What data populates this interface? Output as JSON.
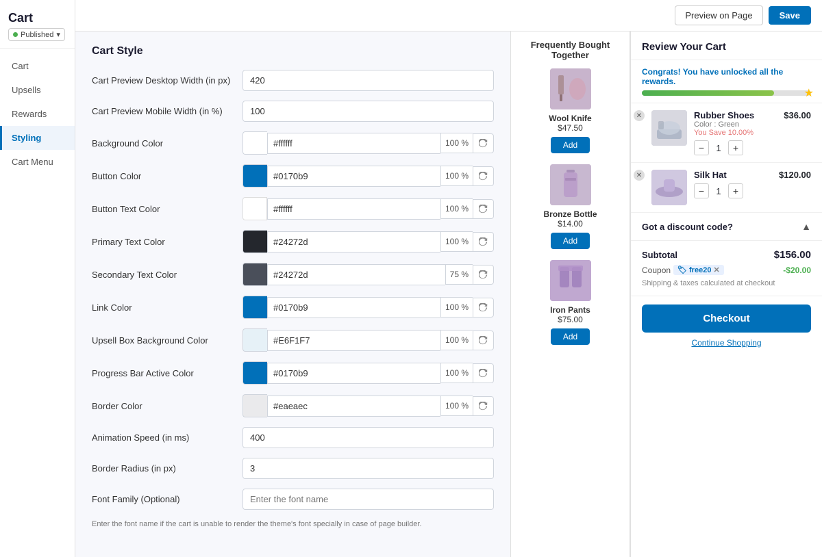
{
  "app": {
    "title": "Cart",
    "published_label": "Published",
    "preview_btn": "Preview on Page",
    "save_btn": "Save"
  },
  "sidebar": {
    "items": [
      {
        "id": "cart",
        "label": "Cart"
      },
      {
        "id": "upsells",
        "label": "Upsells"
      },
      {
        "id": "rewards",
        "label": "Rewards"
      },
      {
        "id": "styling",
        "label": "Styling"
      },
      {
        "id": "cart-menu",
        "label": "Cart Menu"
      }
    ]
  },
  "settings": {
    "panel_title": "Cart Style",
    "fields": [
      {
        "id": "desktop-width",
        "label": "Cart Preview Desktop Width (in px)",
        "type": "text",
        "value": "420"
      },
      {
        "id": "mobile-width",
        "label": "Cart Preview Mobile Width (in %)",
        "type": "text",
        "value": "100"
      },
      {
        "id": "background-color",
        "label": "Background Color",
        "type": "color",
        "hex": "#ffffff",
        "pct": "100"
      },
      {
        "id": "button-color",
        "label": "Button Color",
        "type": "color",
        "hex": "#0170b9",
        "pct": "100",
        "swatch": "#0170b9"
      },
      {
        "id": "button-text-color",
        "label": "Button Text Color",
        "type": "color",
        "hex": "#ffffff",
        "pct": "100"
      },
      {
        "id": "primary-text-color",
        "label": "Primary Text Color",
        "type": "color",
        "hex": "#24272d",
        "pct": "100",
        "swatch": "#24272d"
      },
      {
        "id": "secondary-text-color",
        "label": "Secondary Text Color",
        "type": "color",
        "hex": "#24272d",
        "pct": "75",
        "swatch": "#4a4f5a"
      },
      {
        "id": "link-color",
        "label": "Link Color",
        "type": "color",
        "hex": "#0170b9",
        "pct": "100",
        "swatch": "#0170b9"
      },
      {
        "id": "upsell-box-bg-color",
        "label": "Upsell Box Background Color",
        "type": "color",
        "hex": "#E6F1F7",
        "pct": "100",
        "swatch": "#E6F1F7"
      },
      {
        "id": "progress-bar-color",
        "label": "Progress Bar Active Color",
        "type": "color",
        "hex": "#0170b9",
        "pct": "100",
        "swatch": "#0170b9"
      },
      {
        "id": "border-color",
        "label": "Border Color",
        "type": "color",
        "hex": "#eaeaec",
        "pct": "100",
        "swatch": "#eaeaec"
      },
      {
        "id": "animation-speed",
        "label": "Animation Speed (in ms)",
        "type": "text",
        "value": "400"
      },
      {
        "id": "border-radius",
        "label": "Border Radius (in px)",
        "type": "text",
        "value": "3"
      },
      {
        "id": "font-family",
        "label": "Font Family (Optional)",
        "type": "text",
        "value": "",
        "placeholder": "Enter the font name"
      }
    ],
    "font_hint": "Enter the font name if the cart is unable to render the theme's font specially in case of page builder."
  },
  "frequently_bought": {
    "title": "Frequently Bought Together",
    "items": [
      {
        "name": "Wool Knife",
        "price": "$47.50",
        "img_type": "wool",
        "add_label": "Add"
      },
      {
        "name": "Bronze Bottle",
        "price": "$14.00",
        "img_type": "bronze",
        "add_label": "Add"
      },
      {
        "name": "Iron Pants",
        "price": "$75.00",
        "img_type": "iron",
        "add_label": "Add"
      }
    ]
  },
  "cart_review": {
    "title": "Review Your Cart",
    "rewards_text_prefix": "Congrats! You have unlocked",
    "rewards_text_highlight": "all the rewards.",
    "progress_pct": 78,
    "items": [
      {
        "name": "Rubber Shoes",
        "sub": "Color : Green",
        "save_text": "You Save 10.00%",
        "price": "$36.00",
        "qty": 1,
        "img_type": "rubber"
      },
      {
        "name": "Silk Hat",
        "sub": "",
        "save_text": "",
        "price": "$120.00",
        "qty": 1,
        "img_type": "silk"
      }
    ],
    "discount_label": "Got a discount code?",
    "subtotal_label": "Subtotal",
    "subtotal_value": "$156.00",
    "coupon_label": "Coupon",
    "coupon_code": "free20",
    "coupon_discount": "-$20.00",
    "shipping_note": "Shipping & taxes calculated at checkout",
    "checkout_btn": "Checkout",
    "continue_label": "Continue Shopping"
  }
}
